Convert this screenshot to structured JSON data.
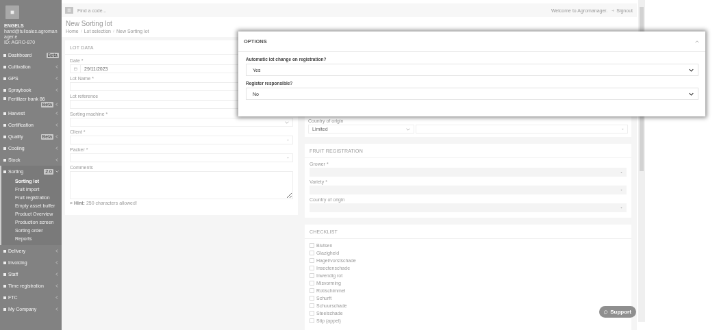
{
  "sidebar": {
    "user": {
      "name": "ENGELS",
      "email": "hand@tulisales.agromanager.e",
      "id": "ID: AGRO-870"
    },
    "items": [
      {
        "label": "Dashboard",
        "badge": "Beta",
        "has_arrow": false,
        "expanded": false
      },
      {
        "label": "Cultivation",
        "has_arrow": true,
        "expanded": false
      },
      {
        "label": "GPS",
        "has_arrow": true,
        "expanded": false
      },
      {
        "label": "Spraybook",
        "has_arrow": true,
        "expanded": false
      },
      {
        "label": "Fertilizer bank 86",
        "badge": "Beta",
        "has_arrow": true,
        "expanded": false
      },
      {
        "label": "Harvest",
        "has_arrow": true,
        "expanded": false
      },
      {
        "label": "Certification",
        "has_arrow": true,
        "expanded": false
      },
      {
        "label": "Quality",
        "badge": "Beta",
        "has_arrow": true,
        "expanded": false
      },
      {
        "label": "Cooling",
        "has_arrow": true,
        "expanded": false
      },
      {
        "label": "Stock",
        "has_arrow": true,
        "expanded": false
      },
      {
        "label": "Sorting",
        "badge": "2.0",
        "has_arrow": true,
        "expanded": true,
        "children": [
          {
            "label": "Sorting lot",
            "selected": true
          },
          {
            "label": "Fruit import",
            "selected": false
          },
          {
            "label": "Fruit registration",
            "selected": false
          },
          {
            "label": "Empty asset buffer",
            "selected": false
          },
          {
            "label": "Product Overview",
            "selected": false
          },
          {
            "label": "Production screen",
            "selected": false
          },
          {
            "label": "Sorting order",
            "selected": false
          },
          {
            "label": "Reports",
            "selected": false
          }
        ]
      },
      {
        "label": "Delivery",
        "has_arrow": true,
        "expanded": false
      },
      {
        "label": "Invoicing",
        "has_arrow": true,
        "expanded": false
      },
      {
        "label": "Staff",
        "has_arrow": true,
        "expanded": false
      },
      {
        "label": "Time registration",
        "has_arrow": true,
        "expanded": false
      },
      {
        "label": "FTC",
        "has_arrow": true,
        "expanded": false
      },
      {
        "label": "My Company",
        "has_arrow": true,
        "expanded": false
      }
    ]
  },
  "topbar": {
    "search_placeholder": "Find a code...",
    "welcome": "Welcome to Agromanager.",
    "signout": "Signout"
  },
  "page": {
    "title": "New Sorting lot",
    "breadcrumb": [
      "Home",
      "Lot selection",
      "New Sorting lot"
    ]
  },
  "lot_data": {
    "title": "LOT DATA",
    "fields": [
      {
        "kind": "date",
        "label": "Date *",
        "value": "29/11/2023"
      },
      {
        "kind": "text",
        "label": "Lot Name *"
      },
      {
        "kind": "text",
        "label": "Lot reference"
      },
      {
        "kind": "select",
        "label": "Sorting machine *"
      },
      {
        "kind": "combo",
        "label": "Client *"
      },
      {
        "kind": "combo",
        "label": "Packer *"
      },
      {
        "kind": "textarea",
        "label": "Comments"
      }
    ],
    "hint": "**Hint:** 250 characters allowed!"
  },
  "origin_row": {
    "label": "Country of origin",
    "value": "Limited"
  },
  "fruit_registration": {
    "title": "FRUIT REGISTRATION",
    "fields": [
      {
        "kind": "combo",
        "label": "Grower *"
      },
      {
        "kind": "combo",
        "label": "Variety *"
      },
      {
        "kind": "combo",
        "label": "Country of origin"
      }
    ]
  },
  "checklist": {
    "title": "CHECKLIST",
    "items": [
      {
        "label": "Blutsen",
        "checked": false
      },
      {
        "label": "Glazigheid",
        "checked": false
      },
      {
        "label": "Hagel/vorstschade",
        "checked": false
      },
      {
        "label": "Insectenschade",
        "checked": false
      },
      {
        "label": "Inwendig rot",
        "checked": false
      },
      {
        "label": "Misvorming",
        "checked": false
      },
      {
        "label": "Rot/schimmel",
        "checked": false
      },
      {
        "label": "Schurft",
        "checked": false
      },
      {
        "label": "Schuurschade",
        "checked": false
      },
      {
        "label": "Steelschade",
        "checked": false
      },
      {
        "label": "Stip (appel)",
        "checked": false
      }
    ]
  },
  "support": {
    "label": "Support"
  },
  "options_modal": {
    "title": "OPTIONS",
    "fields": [
      {
        "label": "Automatic lot change on registration?",
        "value": "Yes"
      },
      {
        "label": "Register responsible?",
        "value": "No"
      }
    ]
  }
}
